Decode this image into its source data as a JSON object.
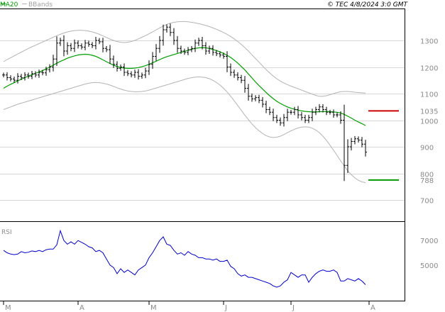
{
  "chart_data": {
    "type": "ohlc",
    "header": {
      "ma_label": "MA20",
      "bbands_label": "BBands",
      "copyright": "© TEC 4/8/2024 3:0 GMT",
      "colors": {
        "ma": "#00a000",
        "bbands": "#b4b4b4",
        "price": "#000000"
      }
    },
    "price_axis": {
      "min": 620,
      "max": 1420,
      "ticks": [
        1300,
        1200,
        1100,
        1000,
        900,
        800,
        700
      ]
    },
    "months": [
      {
        "label": "M",
        "index": 0
      },
      {
        "label": "A",
        "index": 21
      },
      {
        "label": "M",
        "index": 41
      },
      {
        "label": "J",
        "index": 62
      },
      {
        "label": "J",
        "index": 81
      },
      {
        "label": "A",
        "index": 103
      }
    ],
    "levels": [
      {
        "label": "1035",
        "value": 1035,
        "color": "#cc0000"
      },
      {
        "label": "788",
        "value": 775,
        "color": "#009900"
      }
    ],
    "closes": [
      1170,
      1160,
      1155,
      1150,
      1165,
      1160,
      1170,
      1165,
      1175,
      1170,
      1180,
      1178,
      1190,
      1200,
      1230,
      1290,
      1300,
      1260,
      1280,
      1270,
      1290,
      1280,
      1275,
      1290,
      1285,
      1280,
      1300,
      1295,
      1270,
      1265,
      1230,
      1210,
      1195,
      1200,
      1180,
      1175,
      1170,
      1180,
      1165,
      1170,
      1185,
      1210,
      1240,
      1270,
      1300,
      1340,
      1350,
      1330,
      1300,
      1270,
      1260,
      1255,
      1265,
      1270,
      1290,
      1300,
      1280,
      1260,
      1270,
      1255,
      1250,
      1245,
      1240,
      1200,
      1180,
      1170,
      1160,
      1150,
      1120,
      1090,
      1080,
      1085,
      1075,
      1060,
      1040,
      1030,
      1010,
      1000,
      990,
      1010,
      1030,
      1030,
      1040,
      1020,
      1010,
      1000,
      1010,
      1030,
      1040,
      1050,
      1040,
      1030,
      1030,
      1020,
      1020,
      1000,
      830,
      900,
      920,
      930,
      925,
      910,
      880
    ],
    "ma20": [
      1120,
      1128,
      1135,
      1141,
      1148,
      1154,
      1160,
      1166,
      1171,
      1176,
      1181,
      1187,
      1193,
      1200,
      1207,
      1214,
      1221,
      1227,
      1233,
      1238,
      1242,
      1245,
      1247,
      1248,
      1247,
      1244,
      1240,
      1234,
      1227,
      1220,
      1213,
      1207,
      1202,
      1198,
      1196,
      1195,
      1195,
      1196,
      1198,
      1201,
      1205,
      1210,
      1216,
      1222,
      1228,
      1234,
      1239,
      1243,
      1247,
      1251,
      1255,
      1259,
      1263,
      1267,
      1270,
      1272,
      1273,
      1272,
      1270,
      1266,
      1262,
      1257,
      1251,
      1244,
      1236,
      1226,
      1215,
      1202,
      1189,
      1174,
      1159,
      1144,
      1130,
      1117,
      1104,
      1092,
      1081,
      1071,
      1063,
      1056,
      1050,
      1045,
      1041,
      1038,
      1035,
      1033,
      1032,
      1031,
      1031,
      1032,
      1032,
      1033,
      1032,
      1031,
      1030,
      1027,
      1022,
      1015,
      1008,
      1000,
      993,
      987,
      980
    ],
    "bb_upper": [
      1220,
      1228,
      1235,
      1242,
      1249,
      1256,
      1263,
      1270,
      1276,
      1282,
      1288,
      1294,
      1300,
      1306,
      1312,
      1318,
      1323,
      1328,
      1332,
      1335,
      1337,
      1338,
      1338,
      1337,
      1335,
      1332,
      1328,
      1323,
      1317,
      1311,
      1305,
      1300,
      1296,
      1293,
      1292,
      1293,
      1296,
      1300,
      1306,
      1312,
      1318,
      1325,
      1332,
      1340,
      1347,
      1354,
      1360,
      1365,
      1368,
      1370,
      1371,
      1371,
      1370,
      1368,
      1366,
      1363,
      1360,
      1356,
      1352,
      1347,
      1342,
      1336,
      1330,
      1323,
      1315,
      1306,
      1296,
      1285,
      1273,
      1260,
      1246,
      1232,
      1218,
      1204,
      1190,
      1178,
      1166,
      1156,
      1147,
      1140,
      1134,
      1128,
      1123,
      1118,
      1113,
      1108,
      1103,
      1098,
      1093,
      1090,
      1090,
      1092,
      1096,
      1100,
      1104,
      1107,
      1108,
      1108,
      1107,
      1105,
      1104,
      1103,
      1102
    ],
    "bb_lower": [
      1040,
      1045,
      1050,
      1055,
      1060,
      1064,
      1068,
      1072,
      1076,
      1080,
      1084,
      1088,
      1092,
      1096,
      1100,
      1104,
      1108,
      1112,
      1116,
      1120,
      1124,
      1128,
      1132,
      1136,
      1139,
      1141,
      1142,
      1141,
      1139,
      1136,
      1132,
      1127,
      1122,
      1117,
      1113,
      1110,
      1108,
      1107,
      1107,
      1108,
      1110,
      1113,
      1117,
      1121,
      1125,
      1129,
      1133,
      1137,
      1141,
      1145,
      1149,
      1153,
      1157,
      1160,
      1162,
      1163,
      1162,
      1160,
      1156,
      1150,
      1142,
      1132,
      1120,
      1106,
      1090,
      1073,
      1055,
      1037,
      1019,
      1002,
      986,
      972,
      960,
      950,
      942,
      937,
      935,
      936,
      940,
      946,
      953,
      960,
      966,
      971,
      974,
      975,
      974,
      970,
      963,
      953,
      940,
      924,
      906,
      887,
      867,
      847,
      828,
      810,
      795,
      783,
      774,
      768,
      765
    ],
    "rsi": {
      "label": "RSI",
      "ticks": [
        {
          "label": "7000",
          "value": 7000
        },
        {
          "label": "5000",
          "value": 5000
        }
      ],
      "min": 2100,
      "max": 8400,
      "values": [
        6200,
        6000,
        5900,
        5850,
        5900,
        6100,
        6000,
        6050,
        6150,
        6100,
        6200,
        6100,
        6250,
        6300,
        6300,
        6650,
        7800,
        7000,
        6700,
        6900,
        6700,
        7000,
        6850,
        6700,
        6500,
        6400,
        6100,
        6200,
        6000,
        5500,
        5000,
        4800,
        4300,
        4700,
        4400,
        4600,
        4400,
        4200,
        4600,
        4800,
        5000,
        5600,
        6000,
        6500,
        7000,
        7300,
        6700,
        6600,
        6200,
        5900,
        6000,
        5800,
        6100,
        5900,
        5800,
        5600,
        5600,
        5500,
        5500,
        5400,
        5500,
        5300,
        5300,
        5400,
        4900,
        4700,
        4300,
        4100,
        4200,
        4000,
        4000,
        3900,
        3800,
        3700,
        3600,
        3500,
        3300,
        3200,
        3300,
        3600,
        3800,
        4400,
        4200,
        4000,
        4200,
        4200,
        3600,
        4000,
        4300,
        4500,
        4600,
        4500,
        4500,
        4600,
        4400,
        3700,
        3700,
        3900,
        3800,
        3700,
        3900,
        3700,
        3400
      ]
    }
  }
}
